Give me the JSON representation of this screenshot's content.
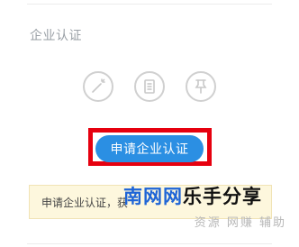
{
  "section": {
    "title": "企业认证"
  },
  "icons": [
    {
      "name": "magic-wand-icon"
    },
    {
      "name": "document-icon"
    },
    {
      "name": "pin-icon"
    }
  ],
  "apply_button": {
    "label": "申请企业认证",
    "color": "#2b8fe3",
    "highlight_color": "#e6000f"
  },
  "tip": {
    "text": "申请企业认证，获"
  },
  "watermark": {
    "main_blue": "南网网",
    "main_black": "乐手分享",
    "sub": "资源 网赚 辅助"
  }
}
